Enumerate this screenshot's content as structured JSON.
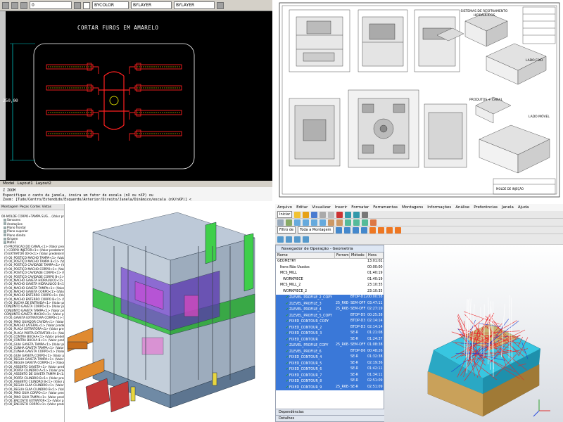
{
  "autocad": {
    "drawing_title": "CORTAR FUROS EM AMARELO",
    "dimension": "250,00",
    "toolbar": {
      "layer_combo": "0",
      "linetype_combo": "BYLAYER",
      "lineweight_combo": "BYLAYER",
      "color_combo": "BYCOLOR"
    },
    "tabs": [
      "Model",
      "Layout1",
      "Layout2"
    ],
    "command_lines": [
      "Z  ZOOM",
      "Especifique o canto da janela, insira um fator de escala (nX ou nXP) ou",
      "Zoom:  [Tudo/Centro/Estendido/Esquerdo/Anterior/Direito/Janela/Dinâmico/escala (nX/nXP)] <"
    ]
  },
  "drawing_sheet": {
    "label_sistemas": "SISTEMAS DE RESFRIAMENTO HIDRÁULICOS",
    "label_lado_fixo": "LADO FIXO",
    "label_produtos": "PRODUTOS + CANAL",
    "label_lado_movel": "LADO MÓVEL",
    "title_block_label": "MOLDE DE INJEÇÃO"
  },
  "solidworks": {
    "tree_tabs": [
      "Montagem",
      "Peças",
      "Cortes",
      "Vistas"
    ],
    "tree_root": "00-MOLDE CORPO+TAMPA SUG... (Valor predeterminado)",
    "tree_items": [
      "Sensores",
      "Anotações",
      "Plano frontal",
      "Plano superior",
      "Plano direito",
      "Origem",
      "Mate1",
      "(f) PROTECAO DO CANAL<1> (Valor predeterminado)",
      "(-) CORPO INJETOR<1> (Valor predeterminado)",
      "(f) EXTRATOR 00-0<1> (Valor predeterminado)",
      "(f) 00_POSTIÇO MACHO TAMPA<1> (Valor predeterminado)",
      "(f) 00_POSTIÇO MACHO TAMPA B<1> (Valor predetermin",
      "(f) 00_POSTIÇO CAVIDADE TAMPA<1> (Valor predetermin",
      "(f) 00_POSTIÇO MACHO CORPO<1> (Valor predetermin",
      "(f) 00_POSTIÇO CAVIDADE CORPO<1> (Valor predetermin",
      "(f) 00_POSTIÇO CAVIDADE CORPO B<1> (Valor predetermin",
      "(f) 00_MACHO GAVETA HIDRAULICO<1> (Valor predeterminado)",
      "(f) 00_MACHO GAVETA HIDRAULICO B<1> (Valor predeterminado)",
      "(f) 00_MACHO GAVETA TAMPA<1> (Valor predetermin",
      "(f) 00_MACHO GAVETA CORPO<1> (Valor predeterminado)",
      "(f) 00_MACHO ENTERRO CORPO<1> (Valor predet",
      "(f) 00_MACHO ENTERRO CORPO B<1> (Valor predet",
      "(f) 00_BUCHA DE ENTRADA<1> (Valor predeterminado)",
      "CONJUNTO GAVETA CORPO<1> (Valor predeterminado)",
      "CONJUNTO GAVETA TAMPA<1> (Valor predetermin",
      "CONJUNTO GAVETA MACHO<1> (Valor predeterminado)",
      "(f) 00_GAVETA EXTRATORA CORPO<1> (Valor predetermin",
      "(f) 00_PINO GUIADOR CAVIDA<1> (Valor predeterminado)",
      "(f) 00_MACHO LATERAL<1> (Valor predeterminado)",
      "(f) 00_PLACA EXTRATORA<1> (Valor predeterminado)",
      "(f) 00_PLACA PORTA EXTRATOR<1> (Valor predeterminado)",
      "(f) 00_CONTRA BUCHA<1> (Valor predeterminado)",
      "(f) 00_CONTRA BUCHA B<1> (Valor predeterminado)",
      "(f) 00_GUIA GAVETA TAMPA<1> (Valor predet",
      "(f) 00_CUNHA GAVETA TAMPA<1> (Valor predetermin",
      "(f) 00_CUNHA GAVETA CORPO<1> (Valor predetermin",
      "(f) 00_GUIA GAVETA CORPO<1> (Valor predeterminado)",
      "(f) 00_REGUA GAVETA TAMPA<1> (Valor predeterminado)",
      "(f) 00_REGUA GAVETA CORPO<1> (Valor predeterminado)",
      "(f) 00_ASSENTO GAVETA<1> (Valor predeterminado)",
      "(f) 00_PORTA CILINDRO A<1> (Valor predeterminado)",
      "(f) 00_ASSENTO DE GAVETA TAMPA B<1> (Valor predet",
      "(f) 00_PORTA CILINDRO B<1> (Valor predeterminado)",
      "(f) 00_ASSENTO CILINDRO B<1> (Valor predeterminado)",
      "(f) 00_REGUA GUIA CILINDRO<1> (Valor predeterminado)",
      "(f) 00_REGUA GUIA CILINDRO B<1> (Valor predeterminado)",
      "(f) 00_PINO GUIA CORPO<1> (Valor predeterminado)",
      "(f) 00_PINO GUIA TAMPA<1> (Valor predeterminado)",
      "(f) 00_ENCOSTO EXTRATOR<1> (Valor predeterminado)",
      "(f) 00_ENCOSTO CORPO<1> (Valor predeterminado)"
    ]
  },
  "nx": {
    "menu": [
      "Arquivo",
      "Editar",
      "Visualizar",
      "Inserir",
      "Formatar",
      "Ferramentas",
      "Montagens",
      "Informações",
      "Análise",
      "Preferências",
      "Janela",
      "Ajuda"
    ],
    "toolbar_combo_1": "Iniciar",
    "toolbar_combo_2": "Filtro de",
    "toolbar_combo_3": "Toda a Montagem",
    "navigator_title": "Navegador de Operação - Geometria",
    "columns": [
      "Nome",
      "Ferram...",
      "Método",
      "Hora"
    ],
    "rows": [
      {
        "name": "GEOMETRY",
        "tool": "",
        "method": "",
        "time": "13:01:02:05",
        "selected": false,
        "indent": 0
      },
      {
        "name": "Itens Não Usados",
        "tool": "",
        "method": "",
        "time": "00:00:00",
        "selected": false,
        "indent": 1
      },
      {
        "name": "MCS_MILL",
        "tool": "",
        "method": "",
        "time": "01:40:19",
        "selected": false,
        "indent": 1
      },
      {
        "name": "WORKPIECE",
        "tool": "",
        "method": "",
        "time": "01:40:19",
        "selected": false,
        "indent": 2
      },
      {
        "name": "MCS_MILL_2",
        "tool": "",
        "method": "",
        "time": "23:10:35",
        "selected": false,
        "indent": 1
      },
      {
        "name": "WORKPIECE_2",
        "tool": "",
        "method": "",
        "time": "23:10:35",
        "selected": false,
        "indent": 2
      },
      {
        "name": "ZLEVEL_PROFILE_2_COPY",
        "tool": "",
        "method": "BTOP-D12",
        "time": "00:00:58",
        "selected": true,
        "indent": 3
      },
      {
        "name": "ZLEVEL_PROFILE_3",
        "tool": "25_R6E-12",
        "method": "SEM-OFF",
        "time": "03:47:11",
        "selected": true,
        "indent": 3
      },
      {
        "name": "ZLEVEL_PROFILE_4",
        "tool": "25_R6E-12",
        "method": "SEM-OFF",
        "time": "02:27:19",
        "selected": true,
        "indent": 3
      },
      {
        "name": "ZLEVEL_PROFILE_5_COPY",
        "tool": "",
        "method": "BTOP-D5",
        "time": "00:25:38",
        "selected": true,
        "indent": 3
      },
      {
        "name": "FIXED_CONTOUR_COPY",
        "tool": "",
        "method": "BTOP-D3",
        "time": "02:14:14",
        "selected": true,
        "indent": 3
      },
      {
        "name": "FIXED_CONTOUR_2",
        "tool": "",
        "method": "BTOP-D3",
        "time": "02:14:14",
        "selected": true,
        "indent": 3
      },
      {
        "name": "FIXED_CONTOUR_3",
        "tool": "",
        "method": "SE-R",
        "time": "01:21:08",
        "selected": true,
        "indent": 3
      },
      {
        "name": "FIXED_CONTOUR",
        "tool": "",
        "method": "SE-R",
        "time": "01:24:37",
        "selected": true,
        "indent": 3
      },
      {
        "name": "ZLEVEL_PROFILE_COPY",
        "tool": "25_R6E-12",
        "method": "SEM-OFF",
        "time": "01:08:38",
        "selected": true,
        "indent": 3
      },
      {
        "name": "ZLEVEL_PROFILE_6",
        "tool": "",
        "method": "BTOP-D6",
        "time": "00:48:26",
        "selected": true,
        "indent": 3
      },
      {
        "name": "FIXED_CONTOUR_4",
        "tool": "",
        "method": "SE-R",
        "time": "01:32:38",
        "selected": true,
        "indent": 3
      },
      {
        "name": "FIXED_CONTOUR_5",
        "tool": "",
        "method": "SE-R",
        "time": "02:19:36",
        "selected": true,
        "indent": 3
      },
      {
        "name": "FIXED_CONTOUR_6",
        "tool": "",
        "method": "SE-R",
        "time": "01:42:11",
        "selected": true,
        "indent": 3
      },
      {
        "name": "FIXED_CONTOUR_7",
        "tool": "",
        "method": "SE-R",
        "time": "01:34:11",
        "selected": true,
        "indent": 3
      },
      {
        "name": "FIXED_CONTOUR_8",
        "tool": "",
        "method": "SE-R",
        "time": "02:51:09",
        "selected": true,
        "indent": 3
      },
      {
        "name": "FIXED_CONTOUR_9",
        "tool": "25_R6E-12",
        "method": "SE-R",
        "time": "02:51:09",
        "selected": true,
        "indent": 3
      }
    ],
    "section_dependencias": "Dependências",
    "section_detalhes": "Detalhes"
  },
  "colors": {
    "autocad_bg": "#000000",
    "autocad_red": "#ff2020",
    "autocad_yellow": "#ffff00",
    "nx_selection": "#3a78d8",
    "nx_part_cyan": "#38c6e0",
    "nx_part_gold": "#c9a15a",
    "nx_toolpath": "#e8262a"
  }
}
